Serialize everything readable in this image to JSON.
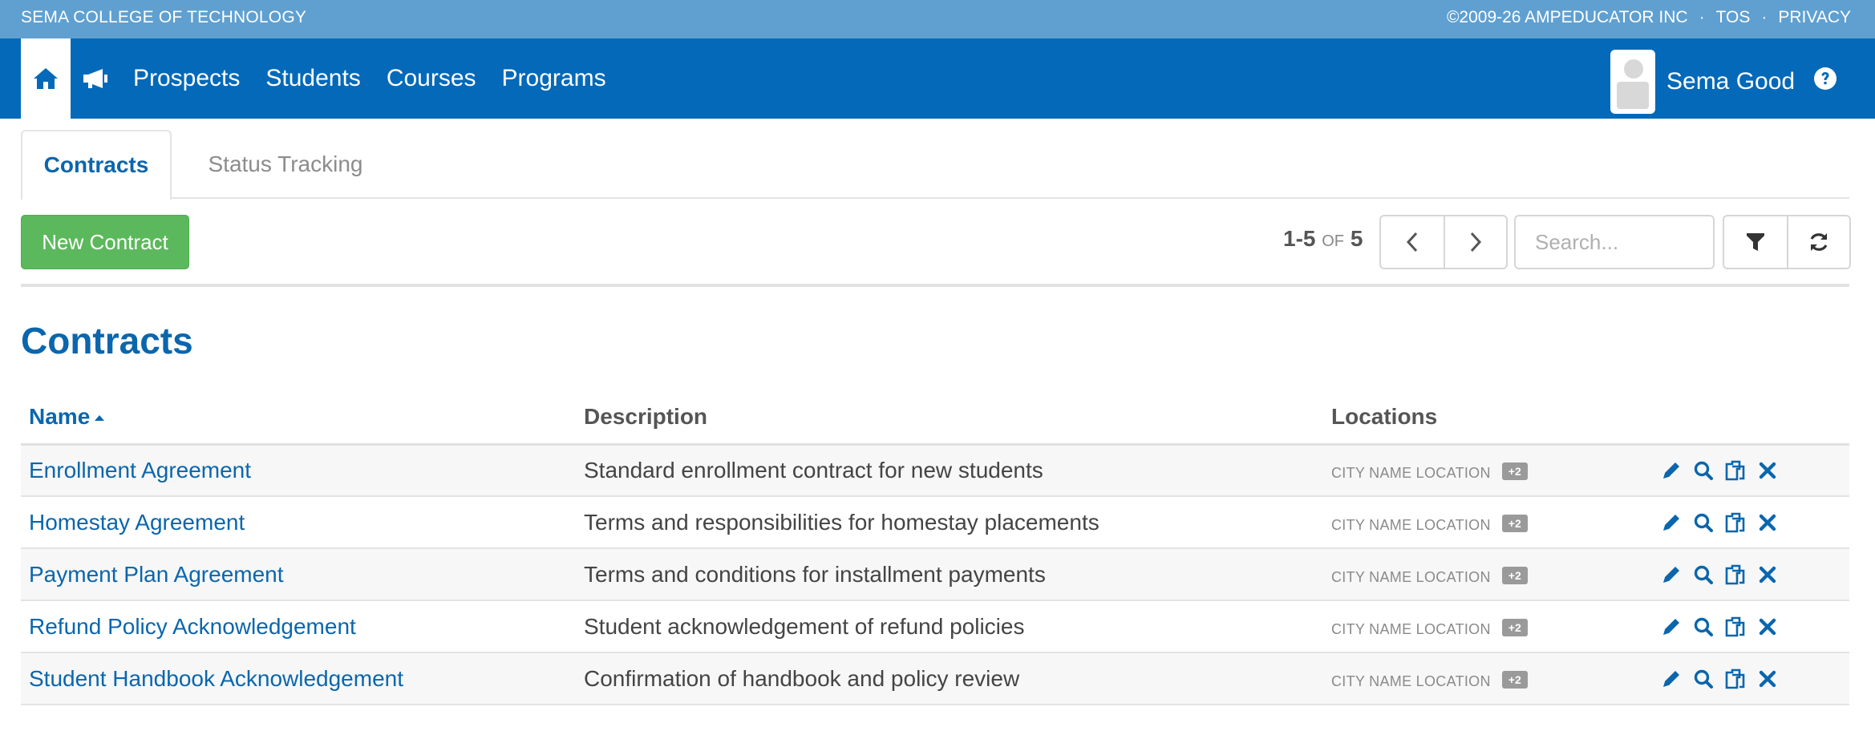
{
  "topbar": {
    "org": "SEMA COLLEGE OF TECHNOLOGY",
    "copyright": "©2009-26 AMPEDUCATOR INC",
    "sep": "·",
    "tos": "TOS",
    "privacy": "PRIVACY"
  },
  "nav": {
    "links": [
      "Prospects",
      "Students",
      "Courses",
      "Programs"
    ],
    "user_name": "Sema Good"
  },
  "tabs": {
    "contracts": "Contracts",
    "status_tracking": "Status Tracking"
  },
  "toolbar": {
    "new_contract": "New Contract",
    "range": "1-5",
    "of_label": "OF",
    "total": "5",
    "search_placeholder": "Search..."
  },
  "page_title": "Contracts",
  "table": {
    "headers": {
      "name": "Name",
      "description": "Description",
      "locations": "Locations"
    },
    "rows": [
      {
        "name": "Enrollment Agreement",
        "description": "Standard enrollment contract for new students",
        "location": "CITY NAME LOCATION",
        "badge": "+2"
      },
      {
        "name": "Homestay Agreement",
        "description": "Terms and responsibilities for homestay placements",
        "location": "CITY NAME LOCATION",
        "badge": "+2"
      },
      {
        "name": "Payment Plan Agreement",
        "description": "Terms and conditions for installment payments",
        "location": "CITY NAME LOCATION",
        "badge": "+2"
      },
      {
        "name": "Refund Policy Acknowledgement",
        "description": "Student acknowledgement of refund policies",
        "location": "CITY NAME LOCATION",
        "badge": "+2"
      },
      {
        "name": "Student Handbook Acknowledgement",
        "description": "Confirmation of handbook and policy review",
        "location": "CITY NAME LOCATION",
        "badge": "+2"
      }
    ]
  },
  "colors": {
    "topbar": "#5fa0d1",
    "navbar": "#0369b8",
    "link": "#0a66ad",
    "success": "#5cb85c"
  },
  "icons": [
    "home-icon",
    "megaphone-icon",
    "help-icon",
    "chevron-left-icon",
    "chevron-right-icon",
    "filter-icon",
    "refresh-icon",
    "edit-icon",
    "search-icon",
    "copy-icon",
    "delete-icon"
  ]
}
